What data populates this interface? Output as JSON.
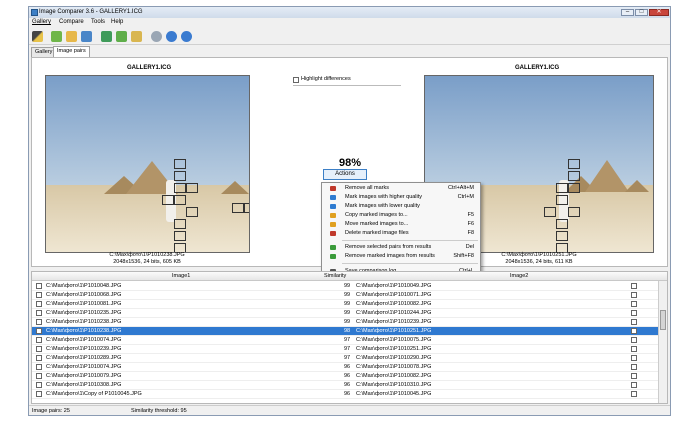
{
  "window": {
    "title": "Image Comparer 3.6 - GALLERY1.ICG",
    "min": "–",
    "max": "□",
    "close": "✕"
  },
  "menu": [
    "Gallery",
    "Compare",
    "Tools",
    "Help"
  ],
  "toolbar_icons": [
    "wand-icon",
    "add-images-icon",
    "open-folder-icon",
    "new-gallery-icon",
    "compare-icon",
    "compare-folders-icon",
    "export-icon",
    "settings-icon",
    "info-icon",
    "help-icon"
  ],
  "tabs": [
    {
      "label": "Gallery"
    },
    {
      "label": "Image pairs",
      "active": true
    }
  ],
  "left_image": {
    "title": "GALLERY1.ICG",
    "path": "C:\\Max\\фото\\1\\P1010238.JPG",
    "info": "2048x1536, 24 bits, 605 KB"
  },
  "right_image": {
    "title": "GALLERY1.ICG",
    "path": "C:\\Max\\фото\\1\\P1010251.JPG",
    "info": "2048x1536, 24 bits, 611 KB"
  },
  "highlight_label": "Highlight differences",
  "similarity": "98%",
  "actions_label": "Actions",
  "context_menu": [
    {
      "label": "Remove all marks",
      "shortcut": "Ctrl+Alt+M",
      "icon": "remove-marks-icon",
      "color": "#c0392b"
    },
    {
      "label": "Mark images with higher quality",
      "shortcut": "Ctrl+M",
      "icon": "mark-higher-icon",
      "color": "#2e7bd0"
    },
    {
      "label": "Mark images with lower quality",
      "shortcut": "",
      "icon": "mark-lower-icon",
      "color": "#2e7bd0"
    },
    {
      "label": "Copy marked images to...",
      "shortcut": "F5",
      "icon": "copy-icon",
      "color": "#e0a020"
    },
    {
      "label": "Move marked images to...",
      "shortcut": "F6",
      "icon": "move-icon",
      "color": "#e0a020"
    },
    {
      "label": "Delete marked image files",
      "shortcut": "F8",
      "icon": "delete-icon",
      "color": "#c0392b"
    },
    {
      "label": "Remove selected pairs from results",
      "shortcut": "Del",
      "icon": "remove-pairs-icon",
      "color": "#3a9b3a"
    },
    {
      "label": "Remove marked images from results",
      "shortcut": "Shift+F8",
      "icon": "remove-marked-icon",
      "color": "#3a9b3a"
    },
    {
      "label": "Save comparison log...",
      "shortcut": "Ctrl+L",
      "icon": "save-log-icon",
      "color": "#555555"
    }
  ],
  "grid": {
    "headers": {
      "image1": "Image1",
      "similarity": "Similarity",
      "image2": "Image2"
    },
    "selected_index": 5,
    "rows": [
      {
        "img1": "C:\\Max\\фото\\1\\P1010048.JPG",
        "sim": "99",
        "img2": "C:\\Max\\фото\\1\\P1010049.JPG"
      },
      {
        "img1": "C:\\Max\\фото\\1\\P1010068.JPG",
        "sim": "99",
        "img2": "C:\\Max\\фото\\1\\P1010071.JPG"
      },
      {
        "img1": "C:\\Max\\фото\\1\\P1010081.JPG",
        "sim": "99",
        "img2": "C:\\Max\\фото\\1\\P1010082.JPG"
      },
      {
        "img1": "C:\\Max\\фото\\1\\P1010235.JPG",
        "sim": "99",
        "img2": "C:\\Max\\фото\\1\\P1010244.JPG"
      },
      {
        "img1": "C:\\Max\\фото\\1\\P1010238.JPG",
        "sim": "99",
        "img2": "C:\\Max\\фото\\1\\P1010239.JPG"
      },
      {
        "img1": "C:\\Max\\фото\\1\\P1010238.JPG",
        "sim": "98",
        "img2": "C:\\Max\\фото\\1\\P1010251.JPG"
      },
      {
        "img1": "C:\\Max\\фото\\1\\P1010074.JPG",
        "sim": "97",
        "img2": "C:\\Max\\фото\\1\\P1010075.JPG"
      },
      {
        "img1": "C:\\Max\\фото\\1\\P1010239.JPG",
        "sim": "97",
        "img2": "C:\\Max\\фото\\1\\P1010251.JPG"
      },
      {
        "img1": "C:\\Max\\фото\\1\\P1010289.JPG",
        "sim": "97",
        "img2": "C:\\Max\\фото\\1\\P1010290.JPG"
      },
      {
        "img1": "C:\\Max\\фото\\1\\P1010074.JPG",
        "sim": "96",
        "img2": "C:\\Max\\фото\\1\\P1010078.JPG"
      },
      {
        "img1": "C:\\Max\\фото\\1\\P1010079.JPG",
        "sim": "96",
        "img2": "C:\\Max\\фото\\1\\P1010082.JPG"
      },
      {
        "img1": "C:\\Max\\фото\\1\\P1010308.JPG",
        "sim": "96",
        "img2": "C:\\Max\\фото\\1\\P1010310.JPG"
      },
      {
        "img1": "C:\\Max\\фото\\1\\Copy of P1010045.JPG",
        "sim": "96",
        "img2": "C:\\Max\\фото\\1\\P1010045.JPG"
      }
    ]
  },
  "status": {
    "pairs": "Image pairs: 25",
    "threshold": "Similarity threshold: 95"
  }
}
